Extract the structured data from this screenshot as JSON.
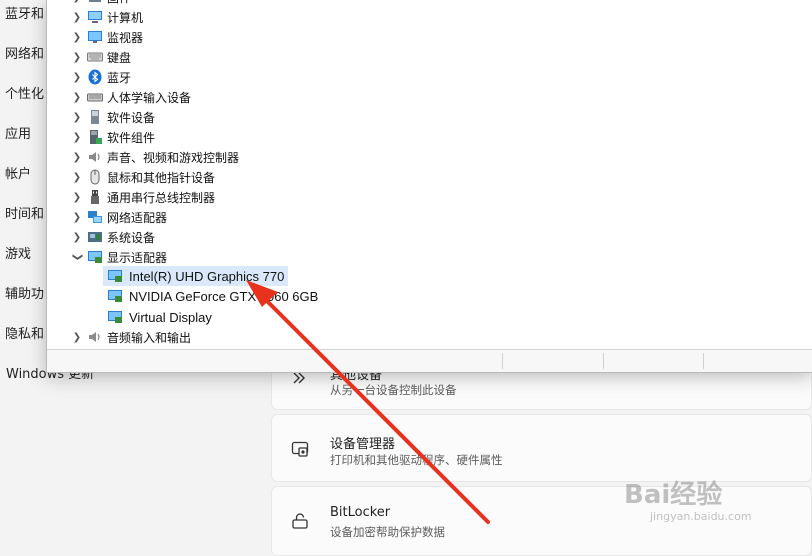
{
  "settings": {
    "nav_items": [
      "蓝牙和",
      "网络和",
      "个性化",
      "应用",
      "帐户",
      "时间和",
      "游戏",
      "辅助功",
      "隐私和",
      "Windows 更新"
    ],
    "cards": [
      {
        "title": "其他设备",
        "subtitle": "从另一台设备控制此设备",
        "icon": "remote-control-icon"
      },
      {
        "title": "设备管理器",
        "subtitle": "打印机和其他驱动程序、硬件属性",
        "icon": "device-manager-icon"
      },
      {
        "title": "BitLocker",
        "subtitle": "设备加密帮助保护数据",
        "icon": "lock-icon"
      }
    ]
  },
  "device_manager": {
    "categories": [
      {
        "label": "固件",
        "icon": "firmware-icon",
        "expanded": false
      },
      {
        "label": "计算机",
        "icon": "computer-icon",
        "expanded": false
      },
      {
        "label": "监视器",
        "icon": "monitor-icon",
        "expanded": false
      },
      {
        "label": "键盘",
        "icon": "keyboard-icon",
        "expanded": false
      },
      {
        "label": "蓝牙",
        "icon": "bluetooth-icon",
        "expanded": false
      },
      {
        "label": "人体学输入设备",
        "icon": "hid-icon",
        "expanded": false
      },
      {
        "label": "软件设备",
        "icon": "software-device-icon",
        "expanded": false
      },
      {
        "label": "软件组件",
        "icon": "software-component-icon",
        "expanded": false
      },
      {
        "label": "声音、视频和游戏控制器",
        "icon": "speaker-icon",
        "expanded": false
      },
      {
        "label": "鼠标和其他指针设备",
        "icon": "mouse-icon",
        "expanded": false
      },
      {
        "label": "通用串行总线控制器",
        "icon": "usb-icon",
        "expanded": false
      },
      {
        "label": "网络适配器",
        "icon": "network-adapter-icon",
        "expanded": false
      },
      {
        "label": "系统设备",
        "icon": "system-device-icon",
        "expanded": false
      },
      {
        "label": "显示适配器",
        "icon": "display-adapter-icon",
        "expanded": true
      },
      {
        "label": "音频输入和输出",
        "icon": "audio-io-icon",
        "expanded": false
      }
    ],
    "display_adapters": [
      {
        "label": "Intel(R) UHD Graphics 770",
        "selected": true
      },
      {
        "label": "NVIDIA GeForce GTX 1060 6GB",
        "selected": false
      },
      {
        "label": "Virtual Display",
        "selected": false
      }
    ]
  },
  "annotation": {
    "color": "#e8321e",
    "target": "Intel(R) UHD Graphics 770"
  },
  "watermark": {
    "brand": "Bai经验",
    "url": "jingyan.baidu.com"
  },
  "colors": {
    "selection": "#d9e9fb",
    "accent": "#0067c0"
  }
}
